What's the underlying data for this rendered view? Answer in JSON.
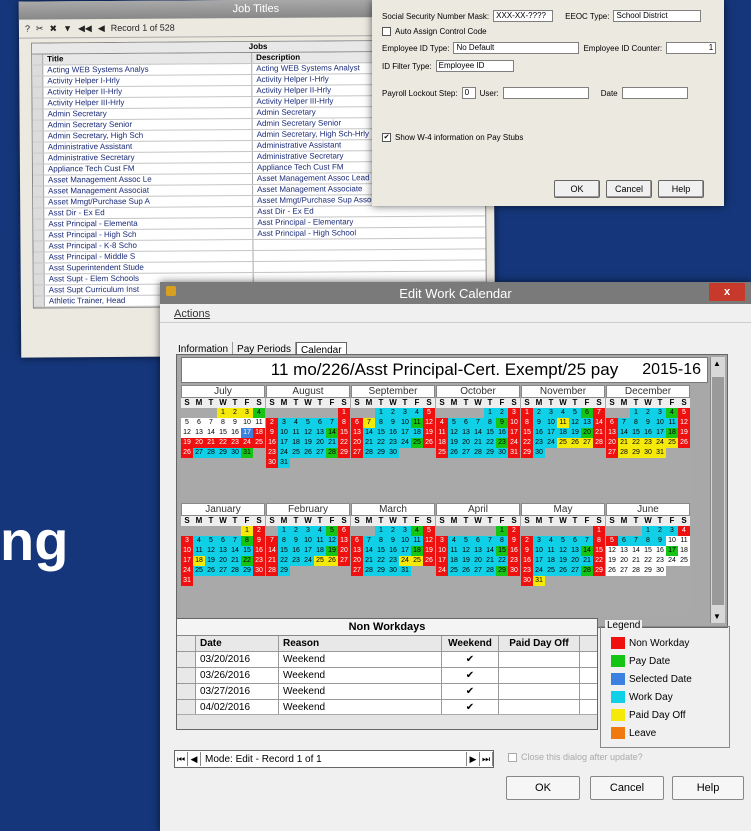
{
  "background_text": "ng",
  "job_window": {
    "title": "Job Titles",
    "record_label": "Record 1 of 528",
    "caption": "Jobs",
    "columns": [
      "Title",
      "Description"
    ],
    "rows": [
      [
        "Acting WEB Systems Analys",
        "Acting WEB Systems Analyst"
      ],
      [
        "Activity Helper I-Hrly",
        "Activity Helper I-Hrly"
      ],
      [
        "Activity Helper II-Hrly",
        "Activity Helper II-Hrly"
      ],
      [
        "Activity Helper III-Hrly",
        "Activity Helper III-Hrly"
      ],
      [
        "Admin Secretary",
        "Admin Secretary"
      ],
      [
        "Admin Secretary Senior",
        "Admin Secretary Senior"
      ],
      [
        "Admin Secretary, High Sch",
        "Admin Secretary, High Sch-Hrly"
      ],
      [
        "Administrative Assistant",
        "Administrative Assistant"
      ],
      [
        "Administrative Secretary",
        "Administrative Secretary"
      ],
      [
        "Appliance Tech Cust FM",
        "Appliance Tech Cust FM"
      ],
      [
        "Asset Management Assoc Le",
        "Asset Management Assoc Lead"
      ],
      [
        "Asset Management Associat",
        "Asset Management Associate"
      ],
      [
        "Asset Mmgt/Purchase Sup A",
        "Asset Mmgt/Purchase Sup Assoc"
      ],
      [
        "Asst Dir - Ex Ed",
        "Asst Dir - Ex Ed"
      ],
      [
        "Asst Principal - Elementa",
        "Asst Principal - Elementary"
      ],
      [
        "Asst Principal - High Sch",
        "Asst Principal - High School"
      ],
      [
        "Asst Principal - K-8 Scho",
        ""
      ],
      [
        "Asst Principal - Middle S",
        ""
      ],
      [
        "Asst Superintendent Stude",
        ""
      ],
      [
        "Asst Supt - Elem Schools",
        ""
      ],
      [
        "Asst Supt Curriculum Inst",
        ""
      ],
      [
        "Athletic Trainer, Head",
        ""
      ]
    ]
  },
  "settings_window": {
    "ssn_mask_label": "Social Security Number Mask:",
    "ssn_mask_value": "XXX-XX-????",
    "eeoc_label": "EEOC Type:",
    "eeoc_value": "School District",
    "auto_assign_label": "Auto Assign Control Code",
    "employee_id_type_label": "Employee ID Type:",
    "employee_id_type_value": "No Default",
    "employee_id_counter_label": "Employee ID Counter:",
    "employee_id_counter_value": "1",
    "id_filter_label": "ID Filter Type:",
    "id_filter_value": "Employee ID",
    "payroll_lockout_label": "Payroll Lockout Step:",
    "payroll_lockout_value": "0",
    "user_label": "User:",
    "date_label": "Date",
    "w4_label": "Show W-4 information on Pay Stubs",
    "ok": "OK",
    "cancel": "Cancel",
    "help": "Help"
  },
  "calendar_window": {
    "title": "Edit Work Calendar",
    "close": "x",
    "menu_actions": "Actions",
    "tabs": [
      "Information",
      "Pay Periods",
      "Calendar"
    ],
    "calendar_title": "11 mo/226/Asst Principal-Cert. Exempt/25 pay",
    "year": "2015-16",
    "dow": [
      "S",
      "M",
      "T",
      "W",
      "T",
      "F",
      "S"
    ],
    "colors": {
      "r": "#ef1010",
      "g": "#16c416",
      "c": "#0fd0e6",
      "y": "#f5e90a",
      "b": "#3c80e0",
      "o": "#f07a10"
    },
    "months": [
      {
        "name": "July",
        "weeks": [
          [
            "",
            "",
            "",
            "1:y",
            "2:y",
            "3:y",
            "4:g"
          ],
          [
            "5",
            "6",
            "7",
            "8",
            "9",
            "10",
            "11"
          ],
          [
            "12",
            "13",
            "14",
            "15",
            "16",
            "17:b",
            "18:r"
          ],
          [
            "19:r",
            "20:r",
            "21:r",
            "22:r",
            "23:r",
            "24:r",
            "25:r"
          ],
          [
            "26:r",
            "27:c",
            "28:c",
            "29:c",
            "30:c",
            "31:g",
            ""
          ]
        ]
      },
      {
        "name": "August",
        "weeks": [
          [
            "",
            "",
            "",
            "",
            "",
            "",
            "1:r"
          ],
          [
            "2:r",
            "3:c",
            "4:c",
            "5:c",
            "6:c",
            "7:c",
            "8:r"
          ],
          [
            "9:r",
            "10:c",
            "11:c",
            "12:c",
            "13:c",
            "14:g",
            "15:r"
          ],
          [
            "16:r",
            "17:c",
            "18:c",
            "19:c",
            "20:c",
            "21:c",
            "22:r"
          ],
          [
            "23:r",
            "24:c",
            "25:c",
            "26:c",
            "27:c",
            "28:g",
            "29:r"
          ],
          [
            "30:r",
            "31:c",
            "",
            "",
            "",
            "",
            ""
          ]
        ]
      },
      {
        "name": "September",
        "weeks": [
          [
            "",
            "",
            "1:c",
            "2:c",
            "3:c",
            "4:c",
            "5:r"
          ],
          [
            "6:r",
            "7:y",
            "8:c",
            "9:c",
            "10:c",
            "11:g",
            "12:r"
          ],
          [
            "13:r",
            "14:c",
            "15:c",
            "16:c",
            "17:c",
            "18:c",
            "19:r"
          ],
          [
            "20:r",
            "21:c",
            "22:c",
            "23:c",
            "24:c",
            "25:g",
            "26:r"
          ],
          [
            "27:r",
            "28:c",
            "29:c",
            "30:c",
            "",
            "",
            ""
          ]
        ]
      },
      {
        "name": "October",
        "weeks": [
          [
            "",
            "",
            "",
            "",
            "1:c",
            "2:c",
            "3:r"
          ],
          [
            "4:r",
            "5:c",
            "6:c",
            "7:c",
            "8:c",
            "9:g",
            "10:r"
          ],
          [
            "11:r",
            "12:c",
            "13:c",
            "14:c",
            "15:c",
            "16:c",
            "17:r"
          ],
          [
            "18:r",
            "19:c",
            "20:c",
            "21:c",
            "22:c",
            "23:g",
            "24:r"
          ],
          [
            "25:r",
            "26:c",
            "27:c",
            "28:c",
            "29:c",
            "30:c",
            "31:r"
          ]
        ]
      },
      {
        "name": "November",
        "weeks": [
          [
            "1:r",
            "2:c",
            "3:c",
            "4:c",
            "5:c",
            "6:g",
            "7:r"
          ],
          [
            "8:r",
            "9:c",
            "10:c",
            "11:y",
            "12:c",
            "13:c",
            "14:r"
          ],
          [
            "15:r",
            "16:c",
            "17:c",
            "18:c",
            "19:c",
            "20:g",
            "21:r"
          ],
          [
            "22:r",
            "23:c",
            "24:c",
            "25:y",
            "26:y",
            "27:y",
            "28:r"
          ],
          [
            "29:r",
            "30:c",
            "",
            "",
            "",
            "",
            ""
          ]
        ]
      },
      {
        "name": "December",
        "weeks": [
          [
            "",
            "",
            "1:c",
            "2:c",
            "3:c",
            "4:g",
            "5:r"
          ],
          [
            "6:r",
            "7:c",
            "8:c",
            "9:c",
            "10:c",
            "11:c",
            "12:r"
          ],
          [
            "13:r",
            "14:c",
            "15:c",
            "16:c",
            "17:c",
            "18:g",
            "19:r"
          ],
          [
            "20:r",
            "21:y",
            "22:y",
            "23:y",
            "24:y",
            "25:y",
            "26:r"
          ],
          [
            "27:r",
            "28:y",
            "29:y",
            "30:y",
            "31:y",
            "",
            ""
          ]
        ]
      },
      {
        "name": "January",
        "weeks": [
          [
            "",
            "",
            "",
            "",
            "",
            "1:y",
            "2:r"
          ],
          [
            "3:r",
            "4:c",
            "5:c",
            "6:c",
            "7:c",
            "8:g",
            "9:r"
          ],
          [
            "10:r",
            "11:c",
            "12:c",
            "13:c",
            "14:c",
            "15:c",
            "16:r"
          ],
          [
            "17:r",
            "18:y",
            "19:c",
            "20:c",
            "21:c",
            "22:g",
            "23:r"
          ],
          [
            "24:r",
            "25:c",
            "26:c",
            "27:c",
            "28:c",
            "29:c",
            "30:r"
          ],
          [
            "31:r",
            "",
            "",
            "",
            "",
            "",
            ""
          ]
        ]
      },
      {
        "name": "February",
        "weeks": [
          [
            "",
            "1:c",
            "2:c",
            "3:c",
            "4:c",
            "5:g",
            "6:r"
          ],
          [
            "7:r",
            "8:c",
            "9:c",
            "10:c",
            "11:c",
            "12:c",
            "13:r"
          ],
          [
            "14:r",
            "15:c",
            "16:c",
            "17:c",
            "18:c",
            "19:g",
            "20:r"
          ],
          [
            "21:r",
            "22:c",
            "23:c",
            "24:c",
            "25:y",
            "26:y",
            "27:r"
          ],
          [
            "28:r",
            "29:c",
            "",
            "",
            "",
            "",
            ""
          ]
        ]
      },
      {
        "name": "March",
        "weeks": [
          [
            "",
            "",
            "1:c",
            "2:c",
            "3:c",
            "4:g",
            "5:r"
          ],
          [
            "6:r",
            "7:c",
            "8:c",
            "9:c",
            "10:c",
            "11:c",
            "12:r"
          ],
          [
            "13:r",
            "14:c",
            "15:c",
            "16:c",
            "17:c",
            "18:g",
            "19:r"
          ],
          [
            "20:r",
            "21:c",
            "22:c",
            "23:c",
            "24:y",
            "25:y",
            "26:r"
          ],
          [
            "27:r",
            "28:c",
            "29:c",
            "30:c",
            "31:c",
            "",
            ""
          ]
        ]
      },
      {
        "name": "April",
        "weeks": [
          [
            "",
            "",
            "",
            "",
            "",
            "1:g",
            "2:r"
          ],
          [
            "3:r",
            "4:c",
            "5:c",
            "6:c",
            "7:c",
            "8:c",
            "9:r"
          ],
          [
            "10:r",
            "11:c",
            "12:c",
            "13:c",
            "14:c",
            "15:g",
            "16:r"
          ],
          [
            "17:r",
            "18:c",
            "19:c",
            "20:c",
            "21:c",
            "22:c",
            "23:r"
          ],
          [
            "24:r",
            "25:c",
            "26:c",
            "27:c",
            "28:c",
            "29:g",
            "30:r"
          ]
        ]
      },
      {
        "name": "May",
        "weeks": [
          [
            "",
            "",
            "",
            "",
            "",
            "",
            "1:r"
          ],
          [
            "2:r",
            "3:c",
            "4:c",
            "5:c",
            "6:c",
            "7:c",
            "8:r"
          ],
          [
            "9:r",
            "10:c",
            "11:c",
            "12:c",
            "13:c",
            "14:g",
            "15:r"
          ],
          [
            "16:r",
            "17:c",
            "18:c",
            "19:c",
            "20:c",
            "21:c",
            "22:r"
          ],
          [
            "23:r",
            "24:c",
            "25:c",
            "26:c",
            "27:c",
            "28:g",
            "29:r"
          ],
          [
            "30:r",
            "31:y",
            "",
            "",
            "",
            "",
            ""
          ]
        ]
      },
      {
        "name": "June",
        "weeks": [
          [
            "",
            "",
            "",
            "1:c",
            "2:c",
            "3:c",
            "4:r"
          ],
          [
            "5:r",
            "6:c",
            "7:c",
            "8:c",
            "9:c",
            "10",
            "11"
          ],
          [
            "12",
            "13",
            "14",
            "15",
            "16",
            "17:g",
            "18"
          ],
          [
            "19",
            "20",
            "21",
            "22",
            "23",
            "24",
            "25"
          ],
          [
            "26",
            "27",
            "28",
            "29",
            "30",
            "",
            ""
          ]
        ]
      }
    ],
    "nonworkdays": {
      "title": "Non Workdays",
      "columns": [
        "Date",
        "Reason",
        "Weekend",
        "Paid Day Off"
      ],
      "rows": [
        [
          "03/20/2016",
          "Weekend",
          "✔",
          ""
        ],
        [
          "03/26/2016",
          "Weekend",
          "✔",
          ""
        ],
        [
          "03/27/2016",
          "Weekend",
          "✔",
          ""
        ],
        [
          "04/02/2016",
          "Weekend",
          "✔",
          ""
        ]
      ]
    },
    "legend": {
      "title": "Legend",
      "items": [
        {
          "label": "Non Workday",
          "color": "#ef1010"
        },
        {
          "label": "Pay Date",
          "color": "#16c416"
        },
        {
          "label": "Selected Date",
          "color": "#3c80e0"
        },
        {
          "label": "Work Day",
          "color": "#0fd0e6"
        },
        {
          "label": "Paid Day Off",
          "color": "#f5e90a"
        },
        {
          "label": "Leave",
          "color": "#f07a10"
        }
      ]
    },
    "mode_text": "Mode: Edit - Record 1 of 1",
    "close_dialog_label": "Close this dialog after update?",
    "ok": "OK",
    "cancel": "Cancel",
    "help": "Help"
  }
}
